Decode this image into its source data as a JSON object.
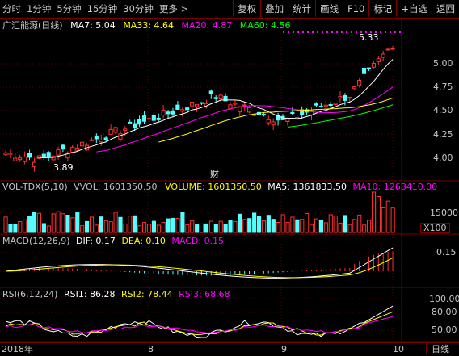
{
  "toolbar": {
    "periods": [
      "分时",
      "1分钟",
      "5分钟",
      "15分钟",
      "30分钟",
      "更多 >"
    ],
    "buttons": [
      "复权",
      "叠加",
      "统计",
      "画线",
      "F10",
      "标记",
      "+自选",
      "返回"
    ]
  },
  "main": {
    "stock_name": "广汇能源(日线)",
    "ma_labels": [
      {
        "text": "MA7: 5.04",
        "color": "#ffffff"
      },
      {
        "text": "MA33: 4.64",
        "color": "#ffff00"
      },
      {
        "text": "MA20: 4.87",
        "color": "#ff00ff"
      },
      {
        "text": "MA60: 4.56",
        "color": "#00ff00"
      }
    ],
    "price_axis": [
      "5.00",
      "4.75",
      "4.50",
      "4.25",
      "4.00"
    ],
    "high_marker": "5.33",
    "low_marker": "3.89",
    "fin_marker": "财"
  },
  "volume": {
    "title": "VOL-TDX(5,10)",
    "labels": [
      {
        "text": "VVOL: 1601350.50",
        "color": "#c0c0c0"
      },
      {
        "text": "VOLUME: 1601350.50",
        "color": "#ffff00"
      },
      {
        "text": "MA5: 1361833.50",
        "color": "#ffffff"
      },
      {
        "text": "MA10: 1268410.00",
        "color": "#ff00ff"
      }
    ],
    "axis": "15000",
    "unit": "X100"
  },
  "macd": {
    "title": "MACD(12,26,9)",
    "labels": [
      {
        "text": "DIF: 0.17",
        "color": "#ffffff"
      },
      {
        "text": "DEA: 0.10",
        "color": "#ffff00"
      },
      {
        "text": "MACD: 0.15",
        "color": "#ff00ff"
      }
    ],
    "axis": "0.15"
  },
  "rsi": {
    "title": "RSI(6,12,24)",
    "labels": [
      {
        "text": "RSI1: 86.28",
        "color": "#ffffff"
      },
      {
        "text": "RSI2: 78.44",
        "color": "#ffff00"
      },
      {
        "text": "RSI3: 68.68",
        "color": "#ff00ff"
      }
    ],
    "axis": [
      "100.00",
      "80.00",
      "50.00"
    ]
  },
  "dates": [
    "2018年",
    "8",
    "9",
    "10"
  ],
  "period_label": "日线",
  "colors": {
    "up": "#ff3232",
    "down": "#54ffff",
    "grid": "#7a0000"
  }
}
